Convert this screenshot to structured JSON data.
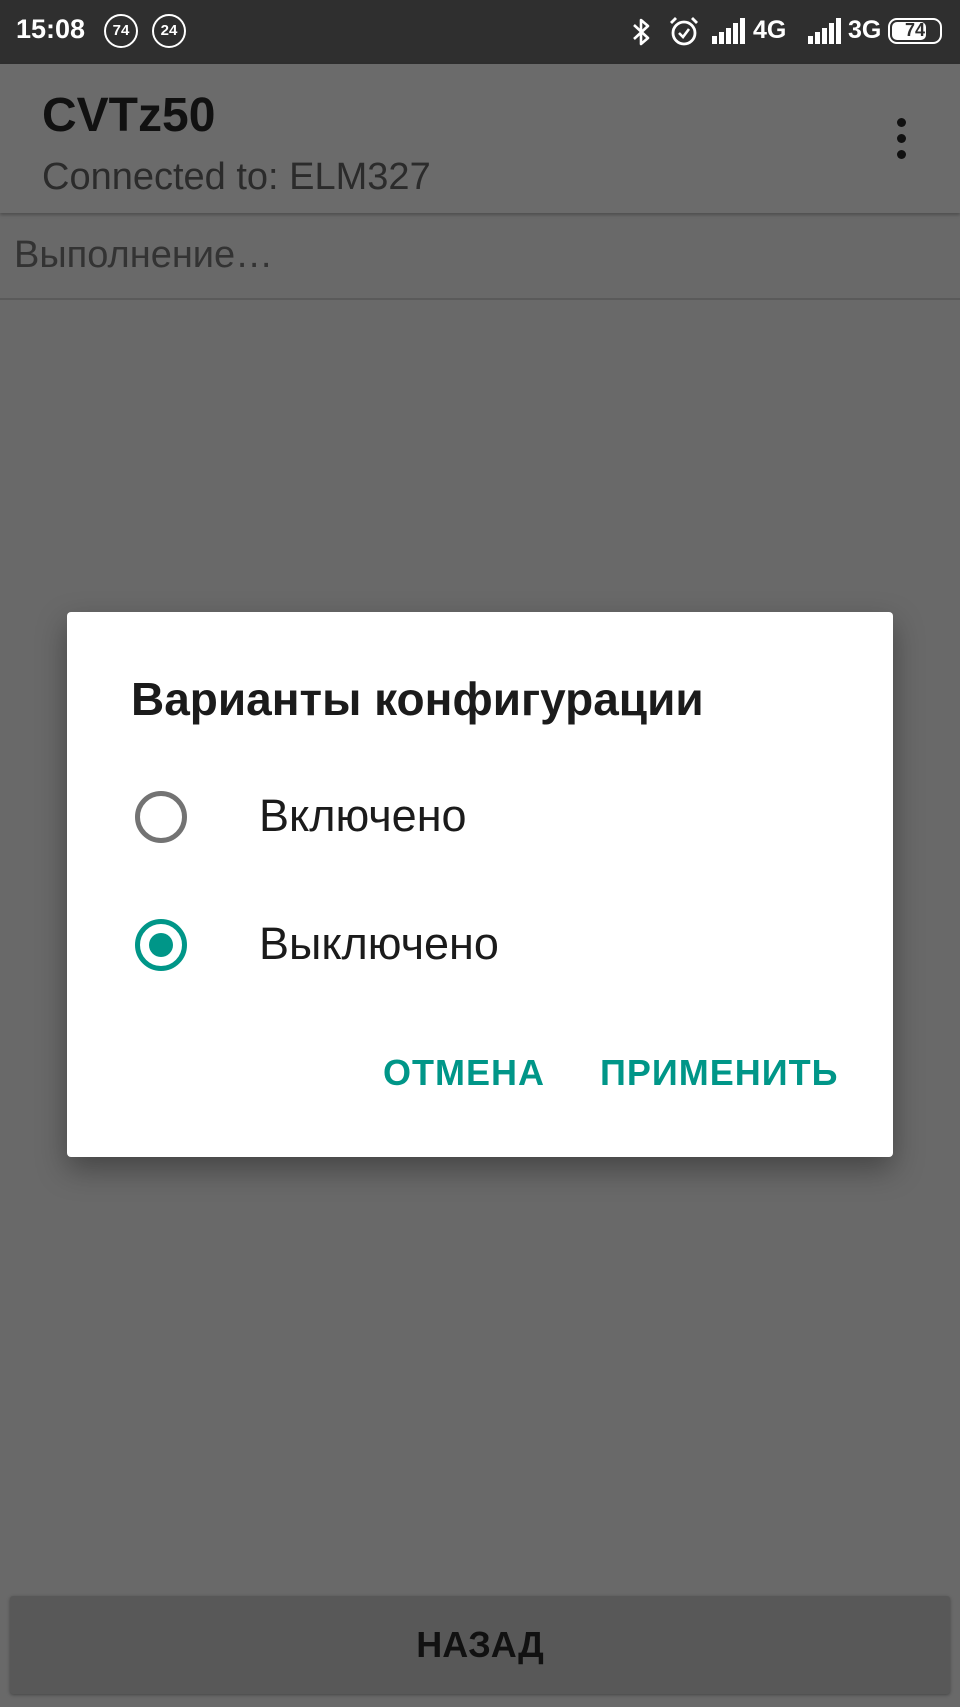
{
  "status_bar": {
    "time": "15:08",
    "notif_badge_1": "74",
    "notif_badge_2": "24",
    "network_1": "4G",
    "network_2": "3G",
    "battery": "74",
    "icons": [
      "bluetooth-icon",
      "alarm-icon",
      "signal-icon"
    ]
  },
  "app_bar": {
    "title": "CVTz50",
    "subtitle": "Connected to: ELM327"
  },
  "progress": {
    "text": "Выполнение…"
  },
  "dialog": {
    "title": "Варианты конфигурации",
    "options": [
      {
        "label": "Включено",
        "selected": false
      },
      {
        "label": "Выключено",
        "selected": true
      }
    ],
    "cancel_label": "ОТМЕНА",
    "apply_label": "ПРИМЕНИТЬ"
  },
  "bottom": {
    "back_label": "НАЗАД"
  },
  "colors": {
    "accent": "#009688",
    "status_bar": "#2f2f2f",
    "scrim_background": "#696969"
  }
}
